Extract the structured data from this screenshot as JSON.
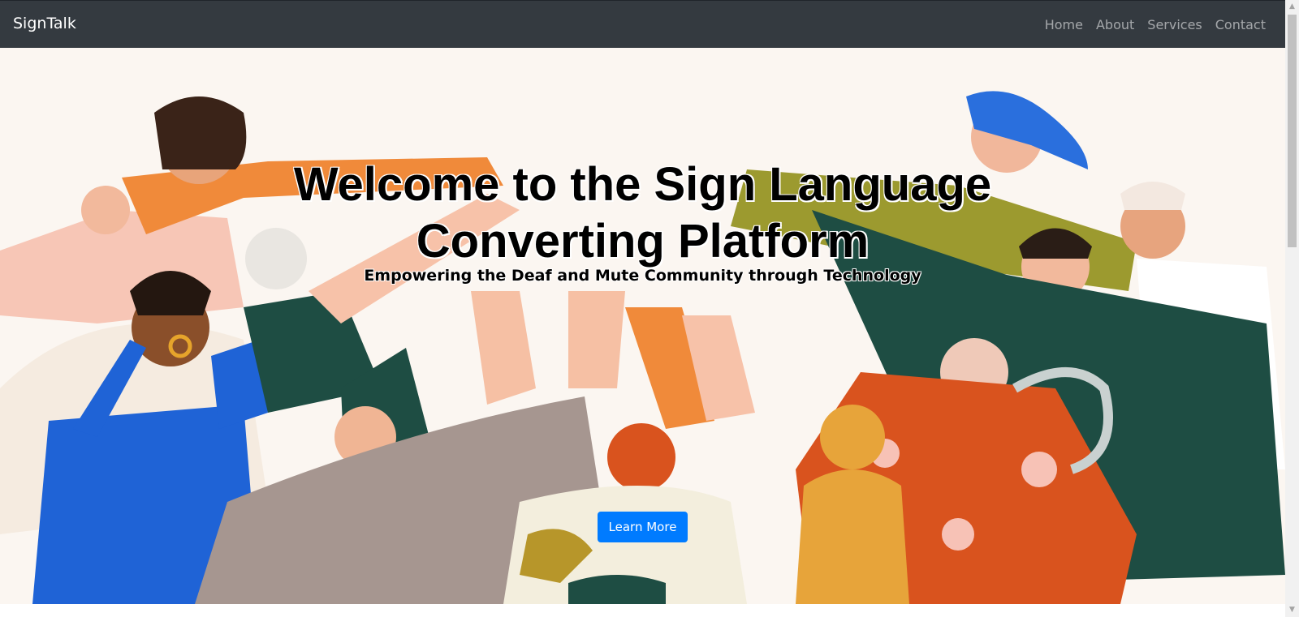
{
  "navbar": {
    "brand": "SignTalk",
    "links": [
      "Home",
      "About",
      "Services",
      "Contact"
    ]
  },
  "hero": {
    "title_line1": "Welcome to the Sign Language",
    "title_line2": "Converting Platform",
    "subtitle": "Empowering the Deaf and Mute Community through Technology",
    "button_label": "Learn More"
  },
  "colors": {
    "navbar_bg": "#343a40",
    "accent": "#007bff"
  },
  "icons": {
    "scroll_up": "▲",
    "scroll_down": "▼"
  }
}
